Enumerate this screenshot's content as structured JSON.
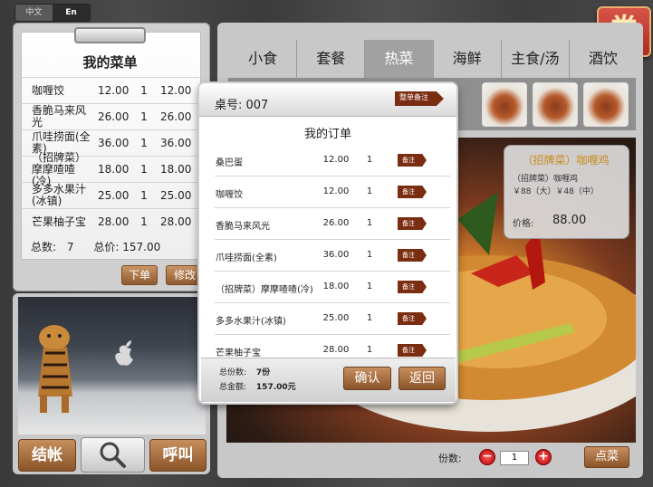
{
  "lang": {
    "zh": "中文",
    "en": "En"
  },
  "coupon": {
    "label": "券"
  },
  "menu": {
    "title": "我的菜单",
    "rows": [
      {
        "name": "咖喱饺",
        "price": "12.00",
        "qty": "1",
        "total": "12.00"
      },
      {
        "name": "香脆马来风光",
        "price": "26.00",
        "qty": "1",
        "total": "26.00"
      },
      {
        "name": "爪哇捞面(全素)",
        "price": "36.00",
        "qty": "1",
        "total": "36.00"
      },
      {
        "name": "（招牌菜）摩摩喳喳(冷)",
        "price": "18.00",
        "qty": "1",
        "total": "18.00"
      },
      {
        "name": "多多水果汁(冰镇)",
        "price": "25.00",
        "qty": "1",
        "total": "25.00"
      },
      {
        "name": "芒果柚子宝",
        "price": "28.00",
        "qty": "1",
        "total": "28.00"
      }
    ],
    "count_label": "总数:",
    "count_value": "7",
    "total_label": "总价:",
    "total_value": "157.00",
    "order_btn": "下单",
    "modify_btn": "修改"
  },
  "bottom": {
    "checkout": "结帐",
    "call": "呼叫"
  },
  "tabs": [
    "小食",
    "套餐",
    "热菜",
    "海鲜",
    "主食/汤",
    "酒饮"
  ],
  "active_tab": "热菜",
  "dish": {
    "title": "（招牌菜）咖喱鸡",
    "price_line1": "（招牌菜）咖喱鸡",
    "price_line2": "￥88（大）￥48（中）",
    "price_label": "价格:",
    "price_value": "88.00"
  },
  "qty": {
    "label": "份数:",
    "value": "1",
    "add_button": "点菜"
  },
  "modal": {
    "table_label": "桌号: 007",
    "whole_note": "整单备注",
    "title": "我的订单",
    "note_label": "备注",
    "rows": [
      {
        "name": "桑巴蛋",
        "price": "12.00",
        "qty": "1"
      },
      {
        "name": "咖喱饺",
        "price": "12.00",
        "qty": "1"
      },
      {
        "name": "香脆马来风光",
        "price": "26.00",
        "qty": "1"
      },
      {
        "name": "爪哇捞面(全素)",
        "price": "36.00",
        "qty": "1"
      },
      {
        "name": "（招牌菜）摩摩喳喳(冷)",
        "price": "18.00",
        "qty": "1"
      },
      {
        "name": "多多水果汁(冰镇)",
        "price": "25.00",
        "qty": "1"
      },
      {
        "name": "芒果柚子宝",
        "price": "28.00",
        "qty": "1"
      }
    ],
    "count_label": "总份数:",
    "count_value": "7份",
    "total_label": "总金额:",
    "total_value": "157.00元",
    "confirm": "确认",
    "back": "返回"
  }
}
